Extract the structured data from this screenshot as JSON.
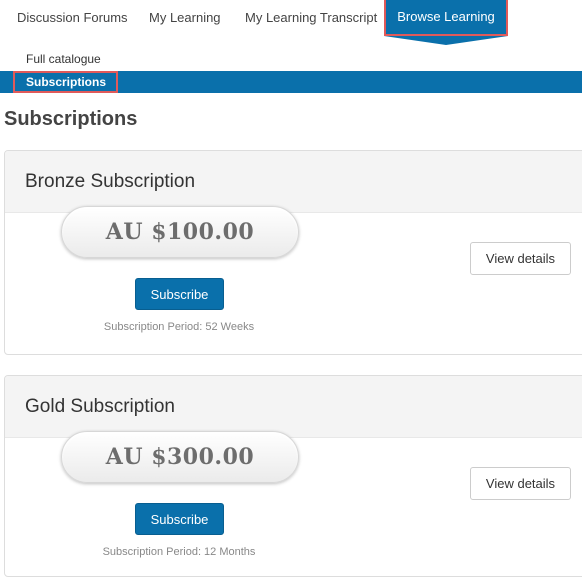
{
  "nav": {
    "tabs": [
      {
        "label": "Discussion Forums"
      },
      {
        "label": "My Learning"
      },
      {
        "label": "My Learning Transcript"
      },
      {
        "label": "Browse Learning",
        "active": true
      }
    ]
  },
  "subnav": {
    "items": [
      {
        "label": "Full catalogue"
      },
      {
        "label": "Subscriptions",
        "active": true
      }
    ]
  },
  "page": {
    "title": "Subscriptions"
  },
  "subscriptions": [
    {
      "name": "Bronze Subscription",
      "price": "AU $100.00",
      "subscribe_label": "Subscribe",
      "period": "Subscription Period: 52 Weeks",
      "details_label": "View details"
    },
    {
      "name": "Gold Subscription",
      "price": "AU $300.00",
      "subscribe_label": "Subscribe",
      "period": "Subscription Period: 12 Months",
      "details_label": "View details"
    }
  ],
  "colors": {
    "accent": "#0a70ab",
    "highlight_border": "#e05a5a"
  }
}
